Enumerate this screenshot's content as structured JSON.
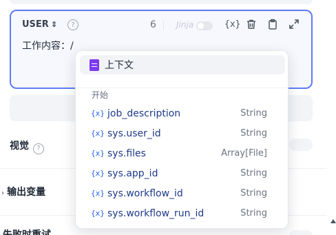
{
  "editor": {
    "role": "USER",
    "role_chevron": "⌃⌄",
    "help": "?",
    "count": "6",
    "jinja_label": "Jinja",
    "content": "工作内容：/"
  },
  "icons": {
    "variable": "{x}",
    "trash": "🗑",
    "clipboard": "📋",
    "expand": "⤢"
  },
  "settings": {
    "vision_label": "视觉",
    "output_label": "输出变量",
    "bottom_label": "失败时重试"
  },
  "popup": {
    "context_label": "上下文",
    "group_label": "开始",
    "variables": [
      {
        "icon": "{x}",
        "name": "job_description",
        "type": "String"
      },
      {
        "icon": "{x}",
        "name": "sys.user_id",
        "type": "String"
      },
      {
        "icon": "{x}",
        "name": "sys.files",
        "type": "Array[File]"
      },
      {
        "icon": "{x}",
        "name": "sys.app_id",
        "type": "String"
      },
      {
        "icon": "{x}",
        "name": "sys.workflow_id",
        "type": "String"
      },
      {
        "icon": "{x}",
        "name": "sys.workflow_run_id",
        "type": "String"
      }
    ]
  },
  "colors": {
    "accent": "#5b7cf5",
    "variable_icon": "#2563eb",
    "context_icon": "#7c3aed"
  }
}
